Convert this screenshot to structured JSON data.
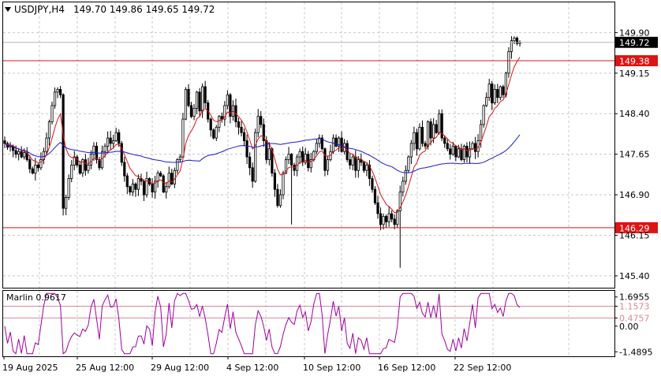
{
  "header": {
    "symbol_tf": "USDJPY,H4",
    "ohlc": "149.70 149.86 149.65 149.72"
  },
  "indicator": {
    "name_value": "Marlin 0.9617"
  },
  "colors": {
    "background": "#ffffff",
    "grid": "#c8c8c8",
    "candle": "#000000",
    "ma_fast": "#dc1414",
    "ma_slow": "#1a1ad2",
    "level": "#dc1414",
    "oscillator": "#a000a0",
    "osc_level": "#d98a9a",
    "price_label_bg": "#000000",
    "level_label_bg": "#dc1414"
  },
  "chart_data": [
    {
      "type": "line",
      "title": "USDJPY,H4",
      "x_ticks": [
        "19 Aug 2025",
        "25 Aug 12:00",
        "29 Aug 12:00",
        "4 Sep 12:00",
        "10 Sep 12:00",
        "16 Sep 12:00",
        "22 Sep 12:00"
      ],
      "y_ticks": [
        "149.90",
        "149.15",
        "148.40",
        "147.65",
        "146.90",
        "146.15",
        "145.40"
      ],
      "ylim": [
        145.18,
        150.46
      ],
      "current_price": "149.72",
      "levels": [
        {
          "name": "149.38",
          "value": 149.38
        },
        {
          "name": "146.29",
          "value": 146.29
        }
      ],
      "candles": {
        "count": 186,
        "close": [
          147.85,
          147.78,
          147.8,
          147.72,
          147.65,
          147.7,
          147.6,
          147.68,
          147.55,
          147.38,
          147.3,
          147.45,
          147.4,
          147.55,
          147.7,
          147.95,
          148.25,
          148.55,
          148.8,
          148.85,
          148.75,
          146.65,
          146.85,
          147.2,
          147.45,
          147.6,
          147.45,
          147.3,
          147.55,
          147.35,
          147.45,
          147.65,
          147.8,
          147.55,
          147.4,
          147.7,
          147.8,
          147.95,
          147.85,
          147.9,
          148.05,
          147.85,
          147.5,
          147.25,
          147.05,
          146.95,
          147.1,
          147.0,
          147.2,
          147.15,
          146.9,
          147.2,
          147.1,
          146.95,
          147.15,
          147.3,
          147.25,
          146.95,
          147.05,
          147.3,
          147.1,
          147.35,
          147.55,
          147.6,
          148.3,
          148.85,
          148.55,
          148.35,
          148.5,
          148.8,
          148.45,
          148.9,
          148.6,
          148.3,
          148.1,
          147.95,
          148.15,
          148.35,
          148.3,
          148.55,
          148.75,
          148.35,
          148.55,
          148.25,
          148.15,
          148.05,
          147.9,
          147.6,
          147.4,
          147.15,
          148.05,
          148.35,
          148.2,
          147.9,
          147.55,
          147.75,
          147.3,
          147.0,
          146.7,
          146.9,
          147.3,
          147.55,
          147.65,
          147.45,
          147.35,
          147.6,
          147.7,
          147.5,
          147.65,
          147.4,
          147.55,
          147.7,
          147.85,
          147.95,
          147.75,
          147.35,
          147.55,
          147.7,
          147.95,
          147.8,
          147.95,
          147.7,
          147.85,
          147.55,
          147.45,
          147.6,
          147.35,
          147.55,
          147.5,
          147.35,
          147.45,
          147.2,
          147.0,
          146.75,
          146.55,
          146.35,
          146.5,
          146.4,
          146.55,
          146.45,
          146.35,
          146.6,
          146.95,
          147.15,
          147.35,
          147.6,
          147.85,
          148.05,
          147.75,
          148.15,
          147.85,
          147.8,
          148.25,
          147.95,
          148.2,
          148.05,
          148.4,
          147.95,
          147.85,
          147.75,
          147.65,
          147.8,
          147.6,
          147.75,
          147.55,
          147.8,
          147.6,
          147.75,
          147.85,
          147.7,
          147.9,
          148.2,
          148.55,
          148.7,
          148.95,
          148.6,
          148.85,
          148.7,
          148.9,
          148.75,
          149.15,
          149.55,
          149.75,
          149.8,
          149.7,
          149.72
        ]
      },
      "series": [
        {
          "name": "",
          "color": "#dc1414",
          "period": 8,
          "kind": "ema"
        },
        {
          "name": "",
          "color": "#1a1ad2",
          "period": 50,
          "kind": "sma"
        }
      ]
    },
    {
      "type": "line",
      "title": "Marlin 0.9617",
      "y_ticks": [
        "1.6955",
        "1.1573",
        "0.4757",
        "0.00",
        "-1.4895"
      ],
      "ylim": [
        -1.75,
        2.05
      ],
      "levels": [
        {
          "name": "1.1573",
          "value": 1.1573
        },
        {
          "name": "0.4757",
          "value": 0.4757
        }
      ],
      "series": [
        {
          "name": "Marlin",
          "color": "#a000a0",
          "derived_from": "close",
          "period": 10
        }
      ]
    }
  ]
}
